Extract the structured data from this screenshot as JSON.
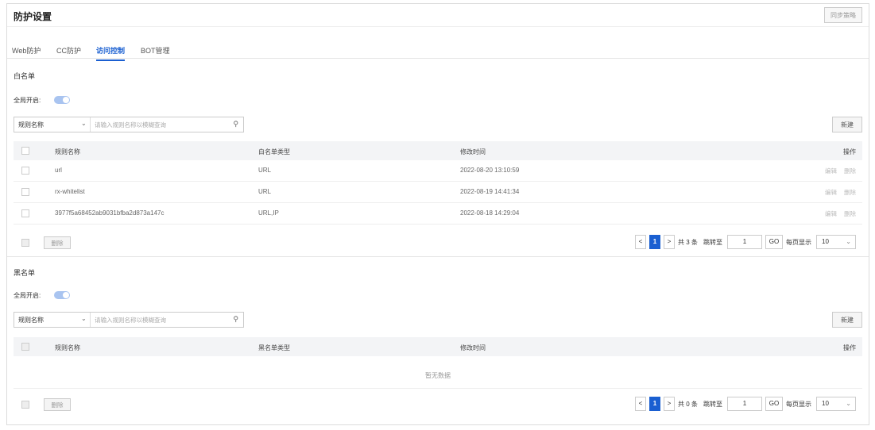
{
  "header": {
    "title": "防护设置",
    "sync_label": "同步策略"
  },
  "tabs": [
    {
      "label": "Web防护",
      "active": false
    },
    {
      "label": "CC防护",
      "active": false
    },
    {
      "label": "访问控制",
      "active": true
    },
    {
      "label": "BOT管理",
      "active": false
    }
  ],
  "whitelist": {
    "title": "白名单",
    "global_label": "全局开启:",
    "global_on": true,
    "filter": {
      "selected": "规则名称",
      "placeholder": "请输入规则名称以模糊查询"
    },
    "new_label": "新建",
    "columns": [
      "规则名称",
      "白名单类型",
      "修改时间",
      "操作"
    ],
    "rows": [
      {
        "name": "url",
        "type": "URL",
        "time": "2022-08-20 13:10:59",
        "edit": "编辑",
        "del": "删除"
      },
      {
        "name": "rx-whitelist",
        "type": "URL",
        "time": "2022-08-19 14:41:34",
        "edit": "编辑",
        "del": "删除"
      },
      {
        "name": "3977f5a68452ab9031bfba2d873a147c",
        "type": "URL,IP",
        "time": "2022-08-18 14:29:04",
        "edit": "编辑",
        "del": "删除"
      }
    ],
    "batch_delete": "删除",
    "pager": {
      "page": "1",
      "total": "共 3 条",
      "jump_label": "跳转至",
      "jump_value": "1",
      "go": "GO",
      "per_page_label": "每页显示",
      "per_page": "10"
    }
  },
  "blacklist": {
    "title": "黑名单",
    "global_label": "全局开启:",
    "global_on": true,
    "filter": {
      "selected": "规则名称",
      "placeholder": "请输入规则名称以模糊查询"
    },
    "new_label": "新建",
    "columns": [
      "规则名称",
      "黑名单类型",
      "修改时间",
      "操作"
    ],
    "empty": "暂无数据",
    "batch_delete": "删除",
    "pager": {
      "page": "1",
      "total": "共 0 条",
      "jump_label": "跳转至",
      "jump_value": "1",
      "go": "GO",
      "per_page_label": "每页显示",
      "per_page": "10"
    }
  },
  "colors": {
    "accent": "#1a5fd1",
    "toggle": "#a9c4f0"
  }
}
